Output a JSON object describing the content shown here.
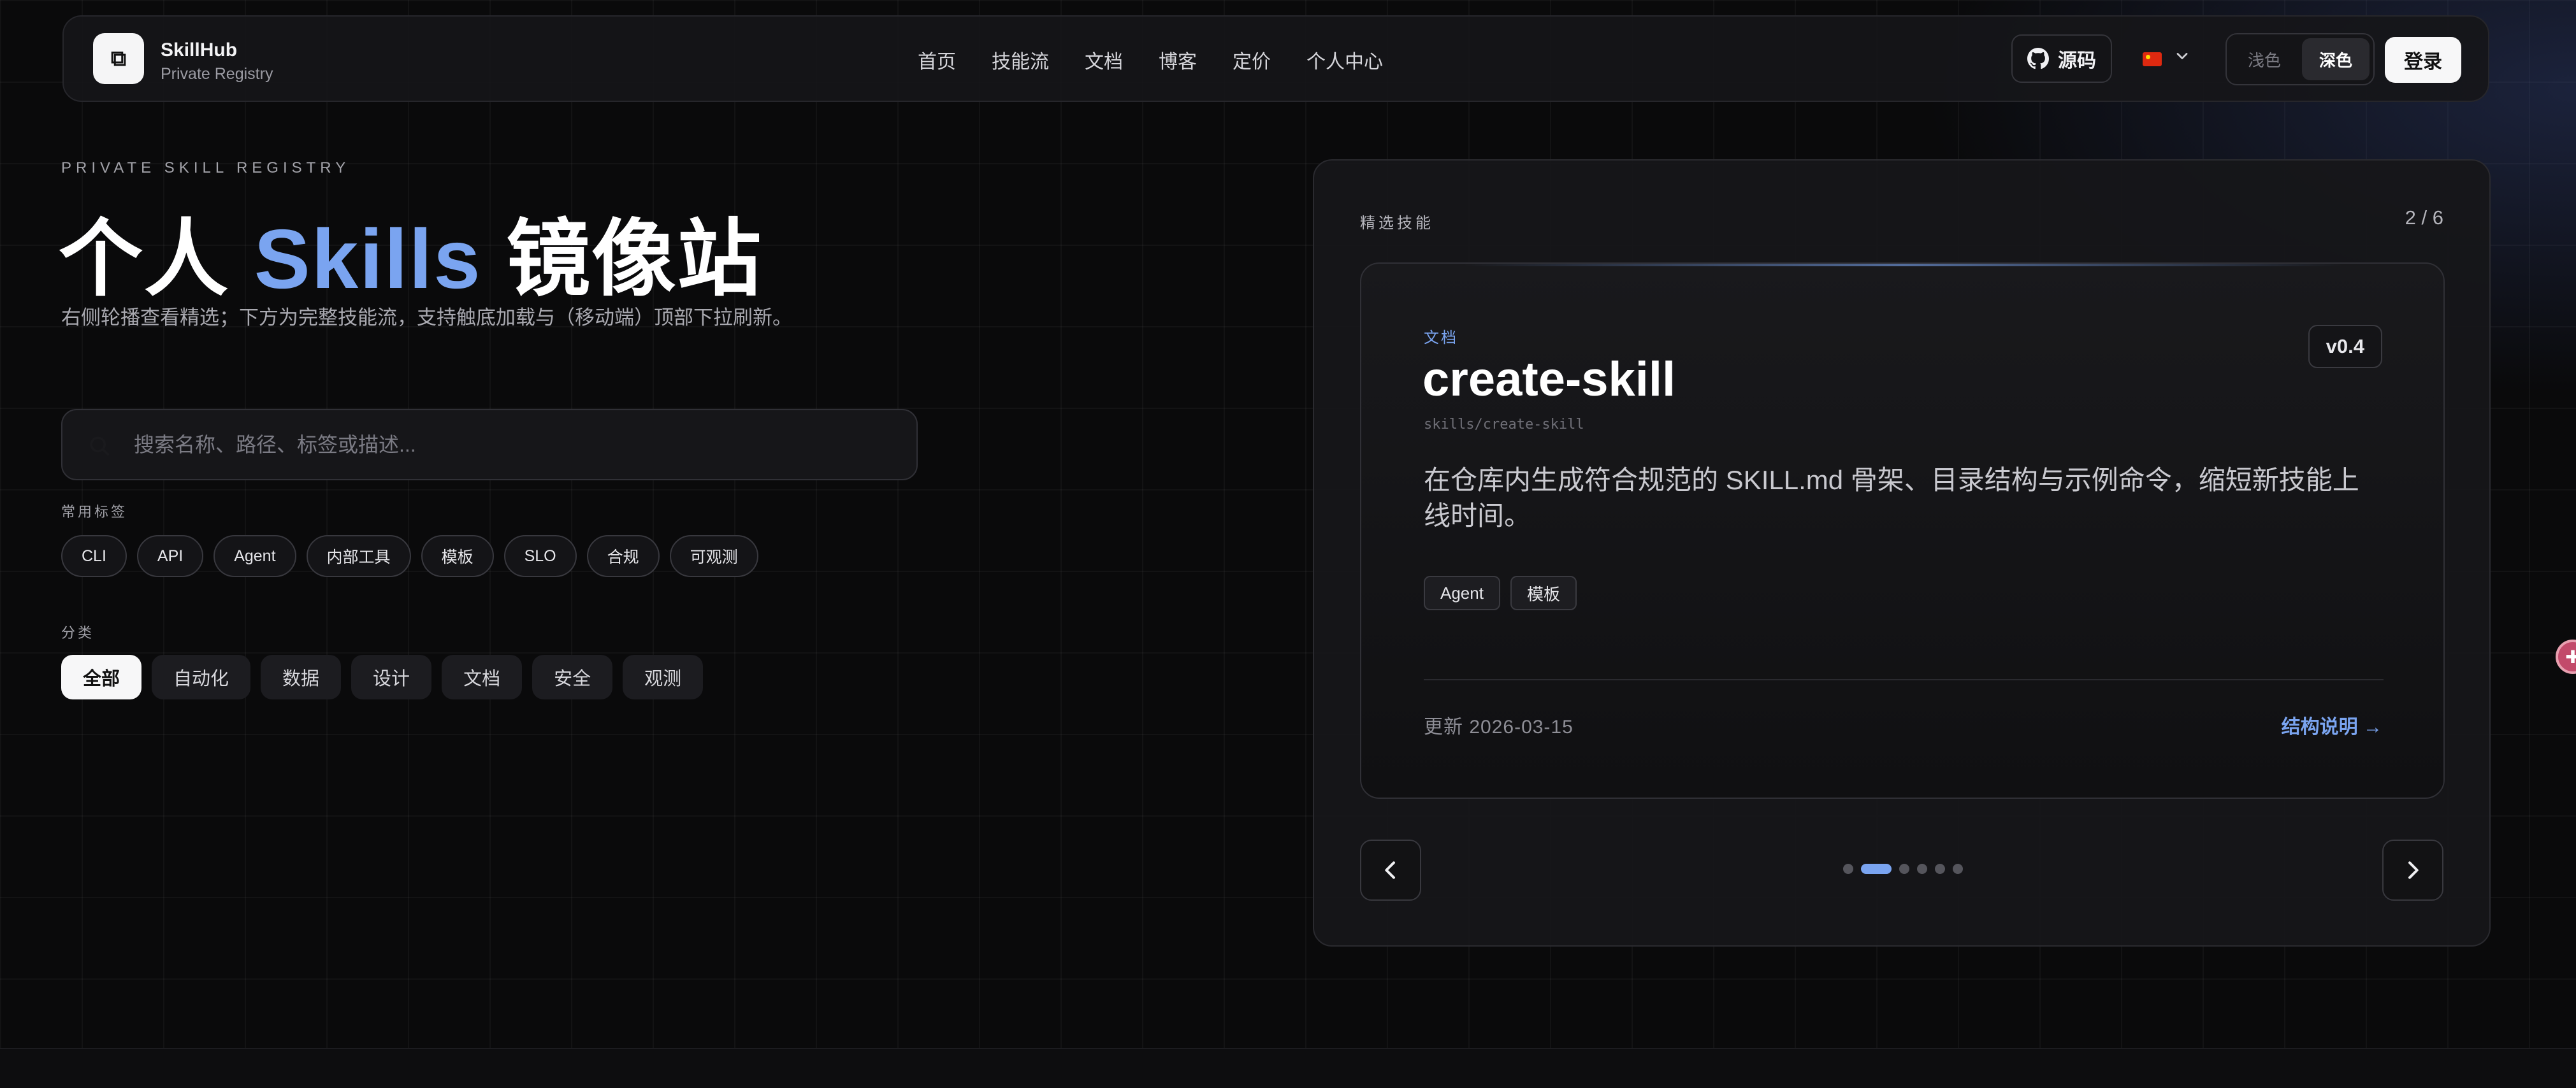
{
  "brand": {
    "logo_glyph": "⧉",
    "name": "SkillHub",
    "subtitle": "Private Registry"
  },
  "nav": [
    {
      "label": "首页"
    },
    {
      "label": "技能流"
    },
    {
      "label": "文档"
    },
    {
      "label": "博客"
    },
    {
      "label": "定价"
    },
    {
      "label": "个人中心"
    }
  ],
  "header_actions": {
    "source_label": "源码",
    "lang_icon": "flag-cn-icon",
    "theme": {
      "light": "浅色",
      "dark": "深色",
      "selected": "dark"
    },
    "login_label": "登录"
  },
  "hero": {
    "eyebrow": "PRIVATE SKILL REGISTRY",
    "title_prefix": "个人",
    "title_accent": "Skills",
    "title_suffix": "镜像站",
    "description": "右侧轮播查看精选；下方为完整技能流，支持触底加载与（移动端）顶部下拉刷新。"
  },
  "search": {
    "placeholder": "搜索名称、路径、标签或描述..."
  },
  "common_tags": {
    "label": "常用标签",
    "items": [
      "CLI",
      "API",
      "Agent",
      "内部工具",
      "模板",
      "SLO",
      "合规",
      "可观测"
    ]
  },
  "categories": {
    "label": "分类",
    "items": [
      "全部",
      "自动化",
      "数据",
      "设计",
      "文档",
      "安全",
      "观测"
    ],
    "selected": "全部"
  },
  "featured": {
    "label": "精选技能",
    "counter": "2 / 6",
    "current_index": 2,
    "total": 6,
    "card": {
      "category": "文档",
      "title": "create-skill",
      "path": "skills/create-skill",
      "version": "v0.4",
      "description": "在仓库内生成符合规范的 SKILL.md 骨架、目录结构与示例命令，缩短新技能上线时间。",
      "tags": [
        "Agent",
        "模板"
      ],
      "updated": "更新 2026-03-15",
      "link_label": "结构说明 →"
    }
  },
  "colors": {
    "accent": "#7aa4f0",
    "background": "#0a0a0b",
    "panel": "#161619"
  }
}
